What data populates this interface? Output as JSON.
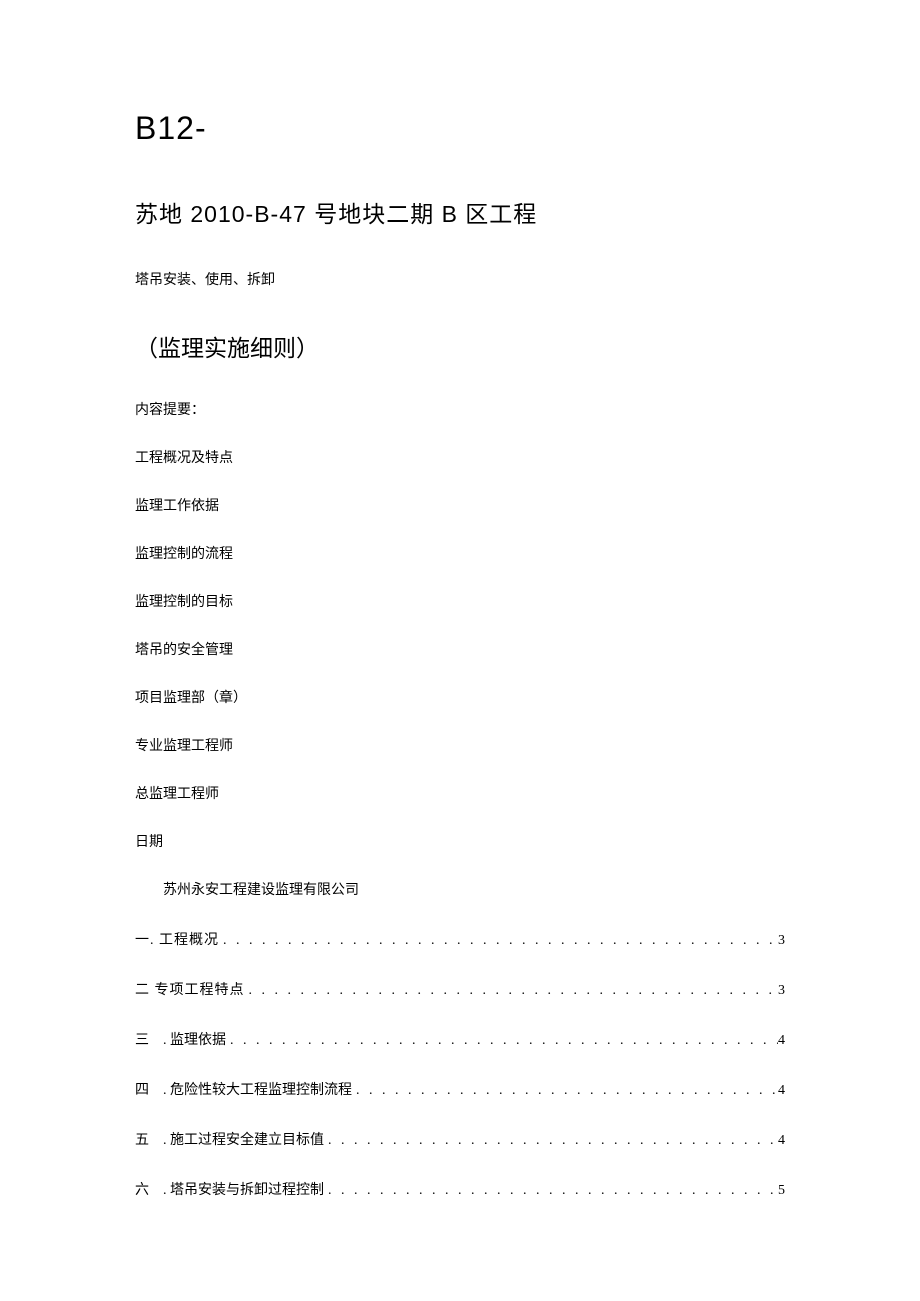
{
  "docNumber": "B12-",
  "title": "苏地 2010-B-47 号地块二期 B 区工程",
  "subtitleSmall": "塔吊安装、使用、拆卸",
  "subtitleLarge": "（监理实施细则）",
  "contentSummaryLabel": "内容提要：",
  "contentItems": [
    "工程概况及特点",
    "监理工作依据",
    "监理控制的流程",
    "监理控制的目标",
    "塔吊的安全管理",
    "项目监理部（章）",
    "专业监理工程师",
    "总监理工程师",
    "日期"
  ],
  "company": "苏州永安工程建设监理有限公司",
  "toc": [
    {
      "label": "一. 工程概况",
      "page": "3",
      "spaced": false
    },
    {
      "label": "二 专项工程特点",
      "page": "3",
      "spaced": false
    },
    {
      "label": "三　. 监理依据",
      "page": "4",
      "spaced": true
    },
    {
      "label": "四　. 危险性较大工程监理控制流程",
      "page": "4",
      "spaced": true
    },
    {
      "label": "五　. 施工过程安全建立目标值",
      "page": "4",
      "spaced": true
    },
    {
      "label": "六　. 塔吊安装与拆卸过程控制",
      "page": "5",
      "spaced": true
    }
  ],
  "dots": ". . . . . . . . . . . . . . . . . . . . . . . . . . . . . . . . . . . . . . . . . . . . . . . . . . . . . . . . . . . . . . . . . . . . . . . . . . . . . . . ."
}
